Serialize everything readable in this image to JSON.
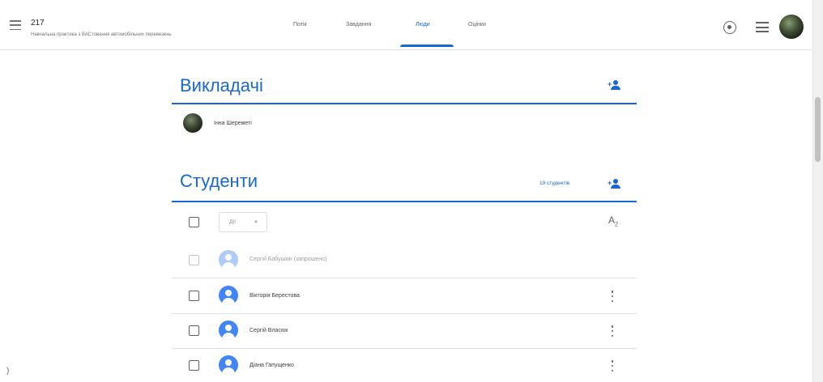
{
  "header": {
    "class_title": "217",
    "class_subtitle": "Навчальна практика з ВАСтовання автомобільних перевезень",
    "tabs": [
      {
        "label": "Потік",
        "active": false
      },
      {
        "label": "Завдання",
        "active": false
      },
      {
        "label": "Люди",
        "active": true
      },
      {
        "label": "Оцінки",
        "active": false
      }
    ],
    "icons": [
      "menu-icon",
      "gear-icon",
      "apps-icon",
      "avatar"
    ]
  },
  "teachers": {
    "title": "Викладачі",
    "list": [
      {
        "name": "Інна Шереметі"
      }
    ]
  },
  "students": {
    "title": "Студенти",
    "count_label": "19 студентів",
    "actions_label": "Дії",
    "rows": [
      {
        "name": "Сергій Бабушкін (запрошено)",
        "invited": true
      },
      {
        "name": "Вікторія Берестова",
        "invited": false
      },
      {
        "name": "Сергій Власюк",
        "invited": false
      },
      {
        "name": "Діана Гапущенко",
        "invited": false
      }
    ]
  },
  "colors": {
    "accent": "#1967d2",
    "avatar_blue": "#4285f4"
  }
}
